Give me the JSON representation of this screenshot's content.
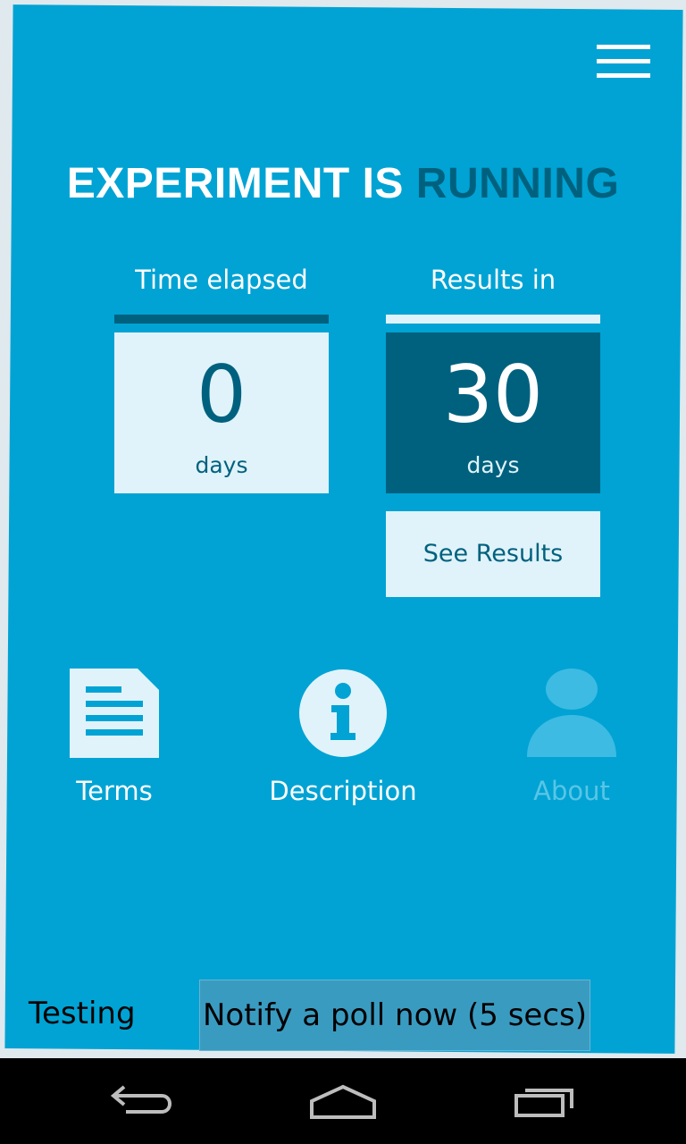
{
  "colors": {
    "background": "#00a3d4",
    "accent_dark": "#00617f",
    "light_box": "#e0f3fa"
  },
  "header": {
    "menu_icon": "hamburger-menu-icon"
  },
  "title": {
    "prefix": "EXPERIMENT IS",
    "status": "RUNNING"
  },
  "stats": {
    "elapsed": {
      "label": "Time elapsed",
      "value": "0",
      "unit": "days"
    },
    "results": {
      "label": "Results in",
      "value": "30",
      "unit": "days"
    }
  },
  "see_results_label": "See Results",
  "nav": {
    "terms": {
      "label": "Terms",
      "icon": "document-icon"
    },
    "description": {
      "label": "Description",
      "icon": "info-icon"
    },
    "about": {
      "label": "About",
      "icon": "person-icon"
    }
  },
  "testing": {
    "label": "Testing",
    "button_label": "Notify a poll now (5 secs)"
  },
  "system_nav": {
    "back_icon": "back-icon",
    "home_icon": "home-icon",
    "recents_icon": "recents-icon"
  }
}
